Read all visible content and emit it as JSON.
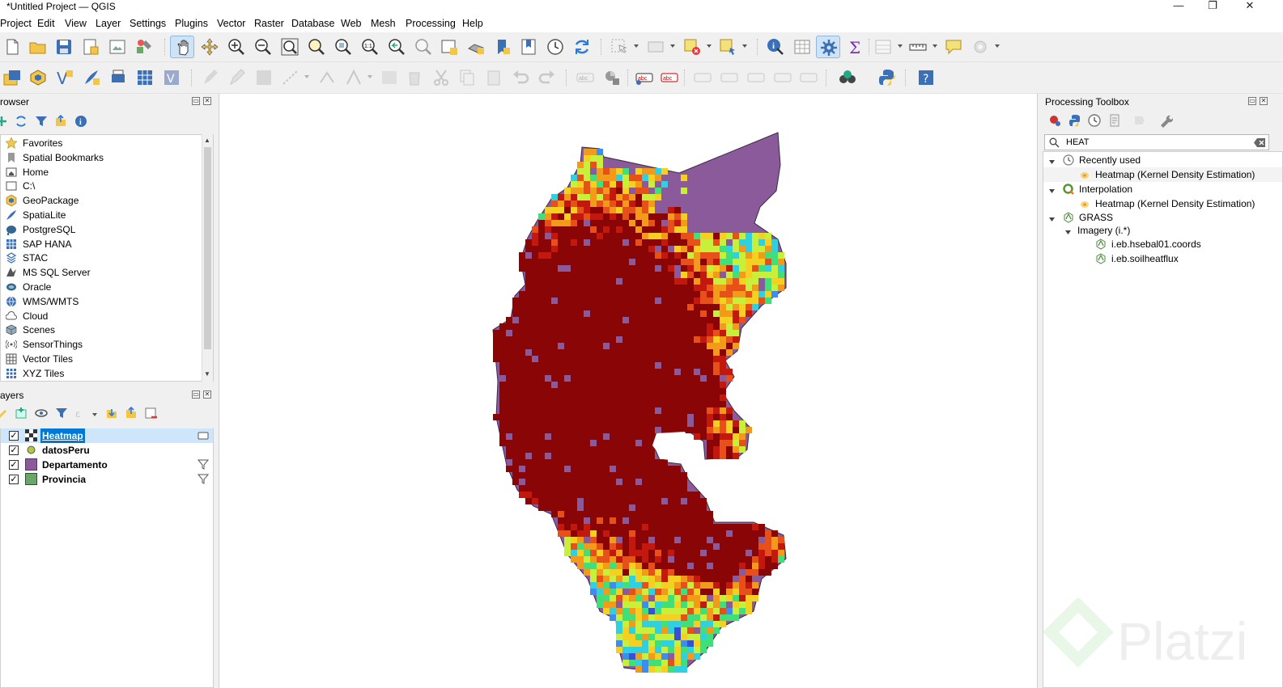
{
  "window": {
    "title": "*Untitled Project — QGIS",
    "controls": [
      "—",
      "❐",
      "✕"
    ]
  },
  "menu": [
    "Project",
    "Edit",
    "View",
    "Layer",
    "Settings",
    "Plugins",
    "Vector",
    "Raster",
    "Database",
    "Web",
    "Mesh",
    "Processing",
    "Help"
  ],
  "browser": {
    "title": "rowser",
    "items": [
      {
        "label": "Favorites",
        "icon": "star-icon"
      },
      {
        "label": "Spatial Bookmarks",
        "icon": "bookmark-icon"
      },
      {
        "label": "Home",
        "icon": "home-folder-icon"
      },
      {
        "label": "C:\\",
        "icon": "folder-icon"
      },
      {
        "label": "GeoPackage",
        "icon": "geopackage-icon"
      },
      {
        "label": "SpatiaLite",
        "icon": "feather-icon"
      },
      {
        "label": "PostgreSQL",
        "icon": "elephant-icon"
      },
      {
        "label": "SAP HANA",
        "icon": "grid-db-icon"
      },
      {
        "label": "STAC",
        "icon": "stac-icon"
      },
      {
        "label": "MS SQL Server",
        "icon": "mssql-icon"
      },
      {
        "label": "Oracle",
        "icon": "oracle-icon"
      },
      {
        "label": "WMS/WMTS",
        "icon": "globe-icon"
      },
      {
        "label": "Cloud",
        "icon": "cloud-icon"
      },
      {
        "label": "Scenes",
        "icon": "cube-icon"
      },
      {
        "label": "SensorThings",
        "icon": "signal-icon"
      },
      {
        "label": "Vector Tiles",
        "icon": "vector-tiles-icon"
      },
      {
        "label": "XYZ Tiles",
        "icon": "xyz-tiles-icon"
      }
    ]
  },
  "layers": {
    "title": "ayers",
    "items": [
      {
        "label": "Heatmap",
        "checked": "✓",
        "selected": true,
        "swatch": "heatmap"
      },
      {
        "label": "datosPeru",
        "checked": "✓",
        "selected": false,
        "swatch": "#b5c934"
      },
      {
        "label": "Departamento",
        "checked": "✓",
        "selected": false,
        "swatch": "#8a5a9a"
      },
      {
        "label": "Provincia",
        "checked": "✓",
        "selected": false,
        "swatch": "#6aa56a"
      }
    ]
  },
  "toolbox": {
    "title": "Processing Toolbox",
    "search_value": "HEAT",
    "tree": [
      {
        "label": "Recently used",
        "level": 0,
        "icon": "clock-icon"
      },
      {
        "label": "Heatmap (Kernel Density Estimation)",
        "level": 1,
        "icon": "heatmap-tool-icon"
      },
      {
        "label": "Interpolation",
        "level": 0,
        "icon": "qgis-icon"
      },
      {
        "label": "Heatmap (Kernel Density Estimation)",
        "level": 1,
        "icon": "heatmap-tool-icon"
      },
      {
        "label": "GRASS",
        "level": 0,
        "icon": "grass-icon"
      },
      {
        "label": "Imagery (i.*)",
        "level": 1,
        "icon": ""
      },
      {
        "label": "i.eb.hsebal01.coords",
        "level": 2,
        "icon": "grass-icon"
      },
      {
        "label": "i.eb.soilheatflux",
        "level": 2,
        "icon": "grass-icon"
      }
    ]
  },
  "watermark": "Platzi",
  "colors": {
    "selection": "#0078d7",
    "department_fill": "#8a5a9a",
    "heat_ramp": [
      "#2b1a66",
      "#3a4fd8",
      "#3d8cf0",
      "#2fd0e0",
      "#3fe07a",
      "#c8f03a",
      "#f5d020",
      "#f39a1a",
      "#e8501a",
      "#c2180e",
      "#8a0606"
    ]
  }
}
